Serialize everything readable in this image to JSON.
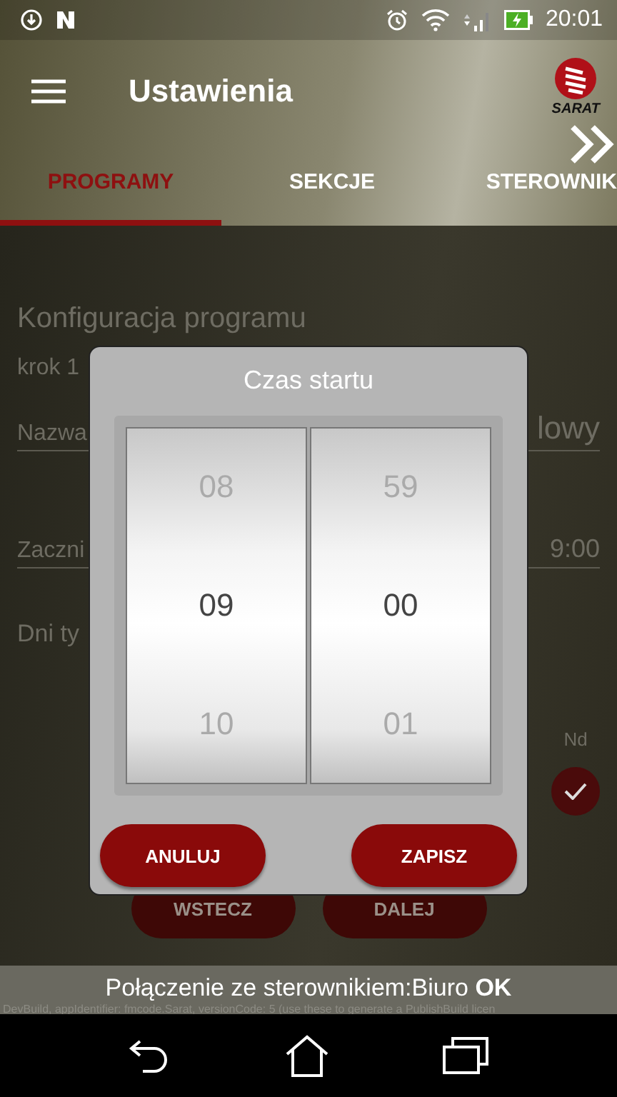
{
  "status_bar": {
    "time": "20:01"
  },
  "toolbar": {
    "title": "Ustawienia",
    "logo_text": "SARAT"
  },
  "tabs": [
    {
      "label": "PROGRAMY",
      "selected": true
    },
    {
      "label": "SEKCJE",
      "selected": false
    },
    {
      "label": "STEROWNIK",
      "selected": false
    }
  ],
  "form": {
    "heading": "Konfiguracja programu",
    "step": "krok 1",
    "fields": [
      {
        "label": "Nazwa",
        "value": "lowy"
      },
      {
        "label": "Zaczni",
        "value": "9:00"
      }
    ],
    "days_label": "Dni ty",
    "days": [
      {
        "label": "Nd",
        "checked": true
      }
    ],
    "buttons": [
      "WSTECZ",
      "DALEJ"
    ]
  },
  "dialog": {
    "title": "Czas startu",
    "columns": [
      {
        "above": "08",
        "value": "09",
        "below": "10"
      },
      {
        "above": "59",
        "value": "00",
        "below": "01"
      }
    ],
    "buttons": [
      "ANULUJ",
      "ZAPISZ"
    ]
  },
  "snackbar": {
    "message": "Połączenie ze sterownikiem:Biuro **OK**",
    "debug": "DevBuild, appIdentifier: fmcode.Sarat, versionCode: 5 (use these to generate a PublishBuild licen"
  }
}
